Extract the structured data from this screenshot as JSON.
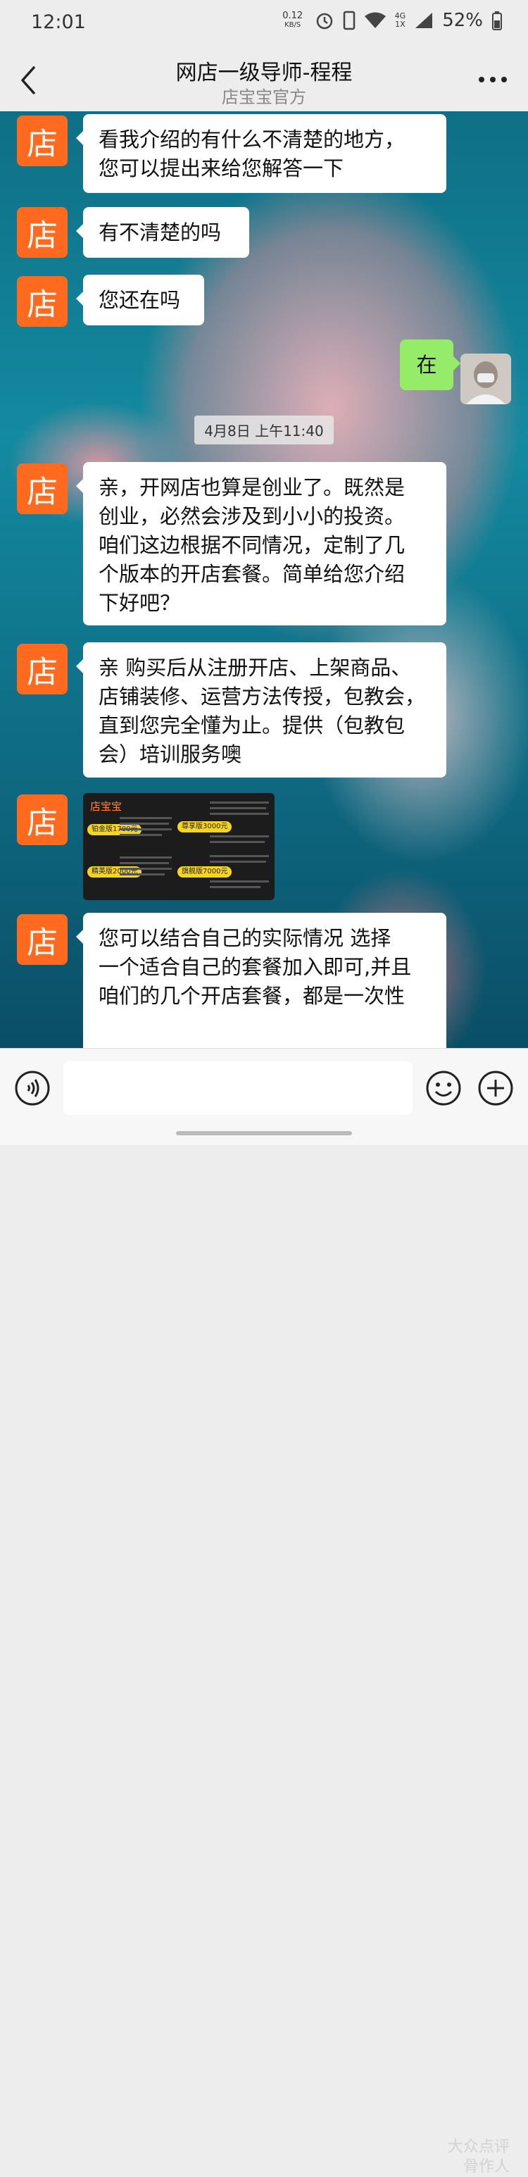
{
  "status_bar": {
    "time": "12:01",
    "net_speed_value": "0.12",
    "net_speed_unit": "KB/S",
    "network": "4G",
    "network_sub": "1X",
    "battery": "52%"
  },
  "header": {
    "title": "网店一级导师-程程",
    "subtitle": "店宝宝官方"
  },
  "shop_avatar_char": "店",
  "messages": [
    {
      "text_line1": "看我介绍的有什么不清楚的地方，",
      "text_line2": "您可以提出来给您解答一下"
    },
    {
      "text": "有不清楚的吗"
    },
    {
      "text": "您还在吗"
    },
    {
      "text": "在"
    },
    {
      "timestamp": "4月8日 上午11:40"
    },
    {
      "lines": [
        "亲，开网店也算是创业了。既然是",
        "创业，必然会涉及到小小的投资。",
        "咱们这边根据不同情况，定制了几",
        "个版本的开店套餐。简单给您介绍",
        "下好吧？"
      ]
    },
    {
      "lines": [
        "亲 购买后从注册开店、上架商品、",
        "店铺装修、运营方法传授，包教会，",
        "直到您完全懂为止。提供（包教包",
        "会）培训服务噢"
      ]
    },
    {
      "card": {
        "brand": "店宝宝",
        "pills": [
          "铂金版1700元",
          "尊享版3000元",
          "精英版2000元",
          "旗舰版7000元"
        ]
      }
    },
    {
      "lines": [
        "您可以结合自己的实际情况  选择",
        "一个适合自己的套餐加入即可,并且",
        "咱们的几个开店套餐，都是一次性"
      ]
    }
  ],
  "watermark": {
    "line1": "大众点评",
    "line2": "骨作人"
  },
  "icons": {
    "back": "chevron-left-icon",
    "more": "more-dots-icon",
    "voice": "voice-icon",
    "emoji": "emoji-icon",
    "plus": "plus-circle-icon"
  }
}
